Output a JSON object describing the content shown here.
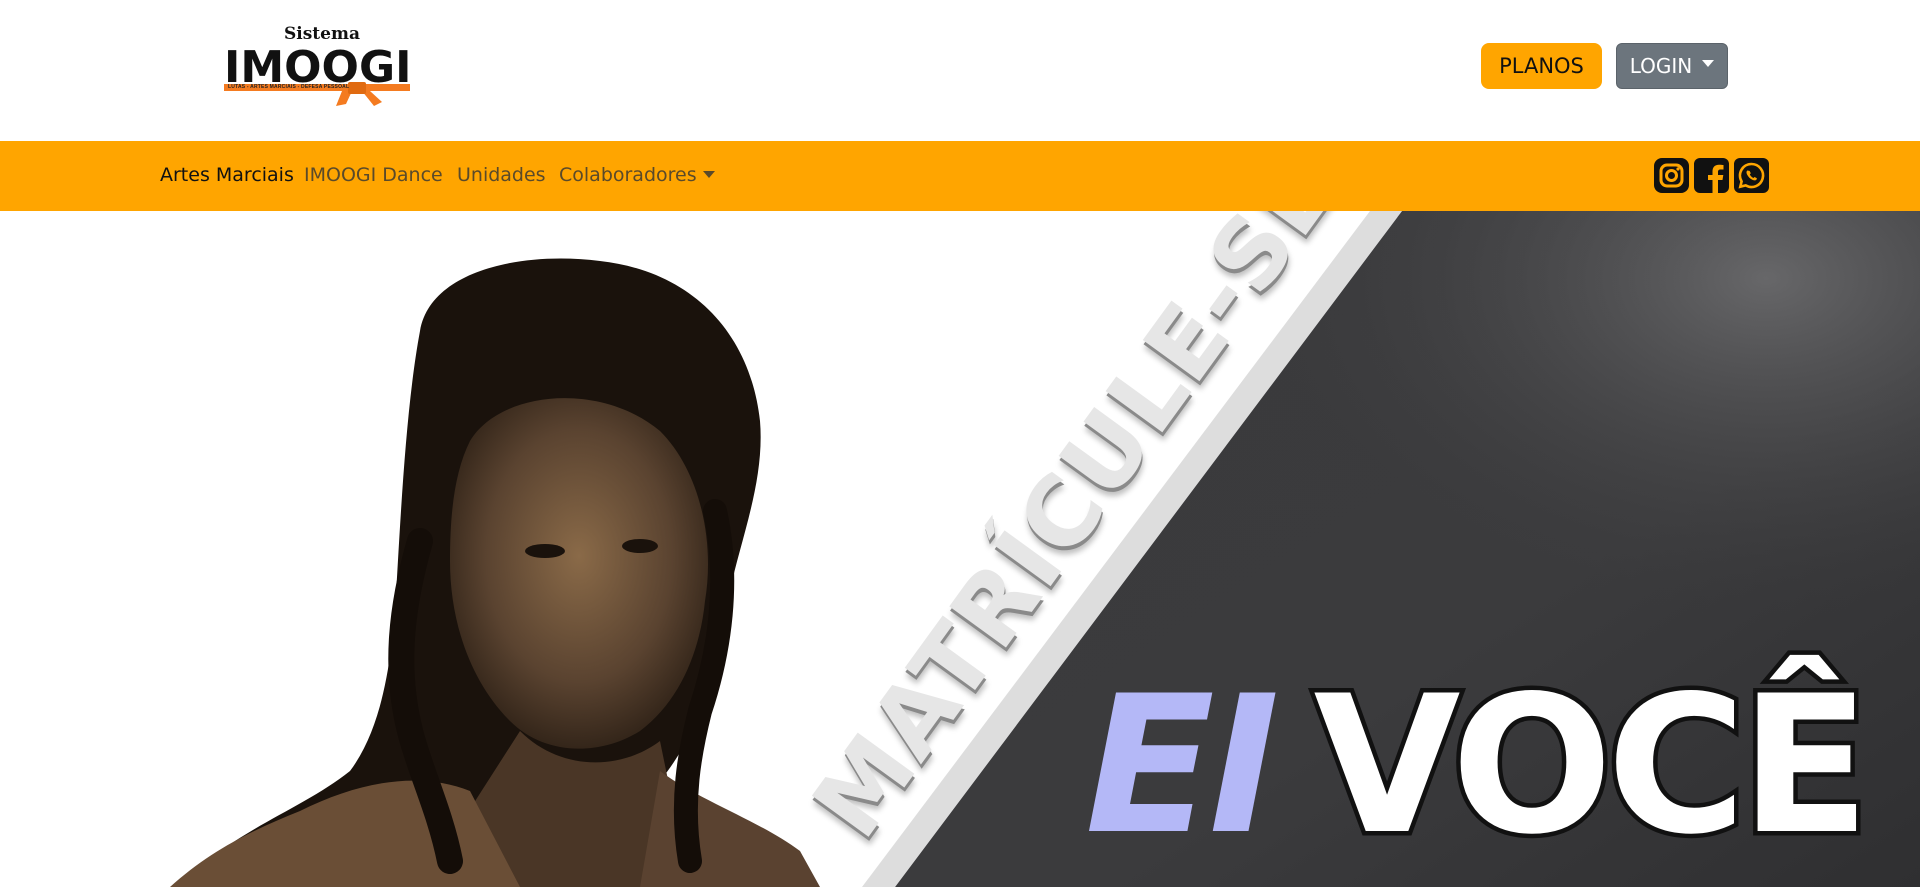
{
  "brand": {
    "top_word": "Sistema",
    "main_word": "IMOOGI",
    "tagline": "LUTAS - ARTES MARCIAIS - DEFESA PESSOAL",
    "accent_color": "#ffa500"
  },
  "header": {
    "planos_label": "PLANOS",
    "login_label": "LOGIN"
  },
  "nav": {
    "items": [
      {
        "label": "Artes Marciais",
        "active": true
      },
      {
        "label": "IMOOGI Dance"
      },
      {
        "label": "Unidades"
      },
      {
        "label": "Colaboradores"
      }
    ],
    "social": [
      "instagram-icon",
      "facebook-icon",
      "whatsapp-icon"
    ]
  },
  "hero": {
    "slogan": "MATRÍCULE-SE",
    "headline_part1": "EI",
    "headline_part2": "VOCÊ",
    "dark_panel_color": "#3b3b3d",
    "ei_color": "#b4b8f7"
  }
}
